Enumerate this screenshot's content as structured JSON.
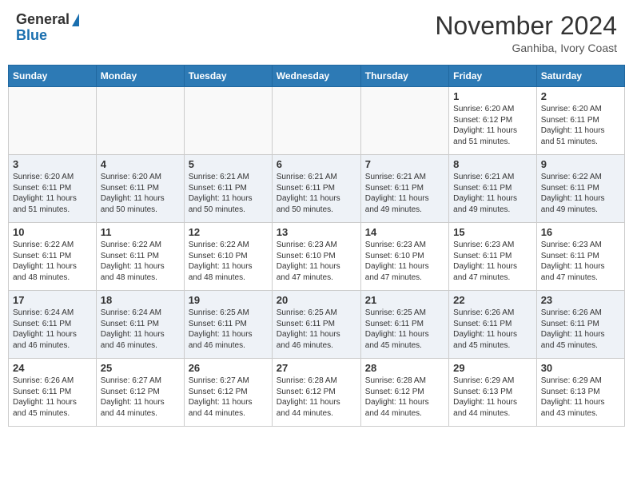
{
  "header": {
    "logo_general": "General",
    "logo_blue": "Blue",
    "month_title": "November 2024",
    "location": "Ganhiba, Ivory Coast"
  },
  "weekdays": [
    "Sunday",
    "Monday",
    "Tuesday",
    "Wednesday",
    "Thursday",
    "Friday",
    "Saturday"
  ],
  "weeks": [
    [
      {
        "day": "",
        "info": ""
      },
      {
        "day": "",
        "info": ""
      },
      {
        "day": "",
        "info": ""
      },
      {
        "day": "",
        "info": ""
      },
      {
        "day": "",
        "info": ""
      },
      {
        "day": "1",
        "info": "Sunrise: 6:20 AM\nSunset: 6:12 PM\nDaylight: 11 hours\nand 51 minutes."
      },
      {
        "day": "2",
        "info": "Sunrise: 6:20 AM\nSunset: 6:11 PM\nDaylight: 11 hours\nand 51 minutes."
      }
    ],
    [
      {
        "day": "3",
        "info": "Sunrise: 6:20 AM\nSunset: 6:11 PM\nDaylight: 11 hours\nand 51 minutes."
      },
      {
        "day": "4",
        "info": "Sunrise: 6:20 AM\nSunset: 6:11 PM\nDaylight: 11 hours\nand 50 minutes."
      },
      {
        "day": "5",
        "info": "Sunrise: 6:21 AM\nSunset: 6:11 PM\nDaylight: 11 hours\nand 50 minutes."
      },
      {
        "day": "6",
        "info": "Sunrise: 6:21 AM\nSunset: 6:11 PM\nDaylight: 11 hours\nand 50 minutes."
      },
      {
        "day": "7",
        "info": "Sunrise: 6:21 AM\nSunset: 6:11 PM\nDaylight: 11 hours\nand 49 minutes."
      },
      {
        "day": "8",
        "info": "Sunrise: 6:21 AM\nSunset: 6:11 PM\nDaylight: 11 hours\nand 49 minutes."
      },
      {
        "day": "9",
        "info": "Sunrise: 6:22 AM\nSunset: 6:11 PM\nDaylight: 11 hours\nand 49 minutes."
      }
    ],
    [
      {
        "day": "10",
        "info": "Sunrise: 6:22 AM\nSunset: 6:11 PM\nDaylight: 11 hours\nand 48 minutes."
      },
      {
        "day": "11",
        "info": "Sunrise: 6:22 AM\nSunset: 6:11 PM\nDaylight: 11 hours\nand 48 minutes."
      },
      {
        "day": "12",
        "info": "Sunrise: 6:22 AM\nSunset: 6:10 PM\nDaylight: 11 hours\nand 48 minutes."
      },
      {
        "day": "13",
        "info": "Sunrise: 6:23 AM\nSunset: 6:10 PM\nDaylight: 11 hours\nand 47 minutes."
      },
      {
        "day": "14",
        "info": "Sunrise: 6:23 AM\nSunset: 6:10 PM\nDaylight: 11 hours\nand 47 minutes."
      },
      {
        "day": "15",
        "info": "Sunrise: 6:23 AM\nSunset: 6:11 PM\nDaylight: 11 hours\nand 47 minutes."
      },
      {
        "day": "16",
        "info": "Sunrise: 6:23 AM\nSunset: 6:11 PM\nDaylight: 11 hours\nand 47 minutes."
      }
    ],
    [
      {
        "day": "17",
        "info": "Sunrise: 6:24 AM\nSunset: 6:11 PM\nDaylight: 11 hours\nand 46 minutes."
      },
      {
        "day": "18",
        "info": "Sunrise: 6:24 AM\nSunset: 6:11 PM\nDaylight: 11 hours\nand 46 minutes."
      },
      {
        "day": "19",
        "info": "Sunrise: 6:25 AM\nSunset: 6:11 PM\nDaylight: 11 hours\nand 46 minutes."
      },
      {
        "day": "20",
        "info": "Sunrise: 6:25 AM\nSunset: 6:11 PM\nDaylight: 11 hours\nand 46 minutes."
      },
      {
        "day": "21",
        "info": "Sunrise: 6:25 AM\nSunset: 6:11 PM\nDaylight: 11 hours\nand 45 minutes."
      },
      {
        "day": "22",
        "info": "Sunrise: 6:26 AM\nSunset: 6:11 PM\nDaylight: 11 hours\nand 45 minutes."
      },
      {
        "day": "23",
        "info": "Sunrise: 6:26 AM\nSunset: 6:11 PM\nDaylight: 11 hours\nand 45 minutes."
      }
    ],
    [
      {
        "day": "24",
        "info": "Sunrise: 6:26 AM\nSunset: 6:11 PM\nDaylight: 11 hours\nand 45 minutes."
      },
      {
        "day": "25",
        "info": "Sunrise: 6:27 AM\nSunset: 6:12 PM\nDaylight: 11 hours\nand 44 minutes."
      },
      {
        "day": "26",
        "info": "Sunrise: 6:27 AM\nSunset: 6:12 PM\nDaylight: 11 hours\nand 44 minutes."
      },
      {
        "day": "27",
        "info": "Sunrise: 6:28 AM\nSunset: 6:12 PM\nDaylight: 11 hours\nand 44 minutes."
      },
      {
        "day": "28",
        "info": "Sunrise: 6:28 AM\nSunset: 6:12 PM\nDaylight: 11 hours\nand 44 minutes."
      },
      {
        "day": "29",
        "info": "Sunrise: 6:29 AM\nSunset: 6:13 PM\nDaylight: 11 hours\nand 44 minutes."
      },
      {
        "day": "30",
        "info": "Sunrise: 6:29 AM\nSunset: 6:13 PM\nDaylight: 11 hours\nand 43 minutes."
      }
    ]
  ]
}
